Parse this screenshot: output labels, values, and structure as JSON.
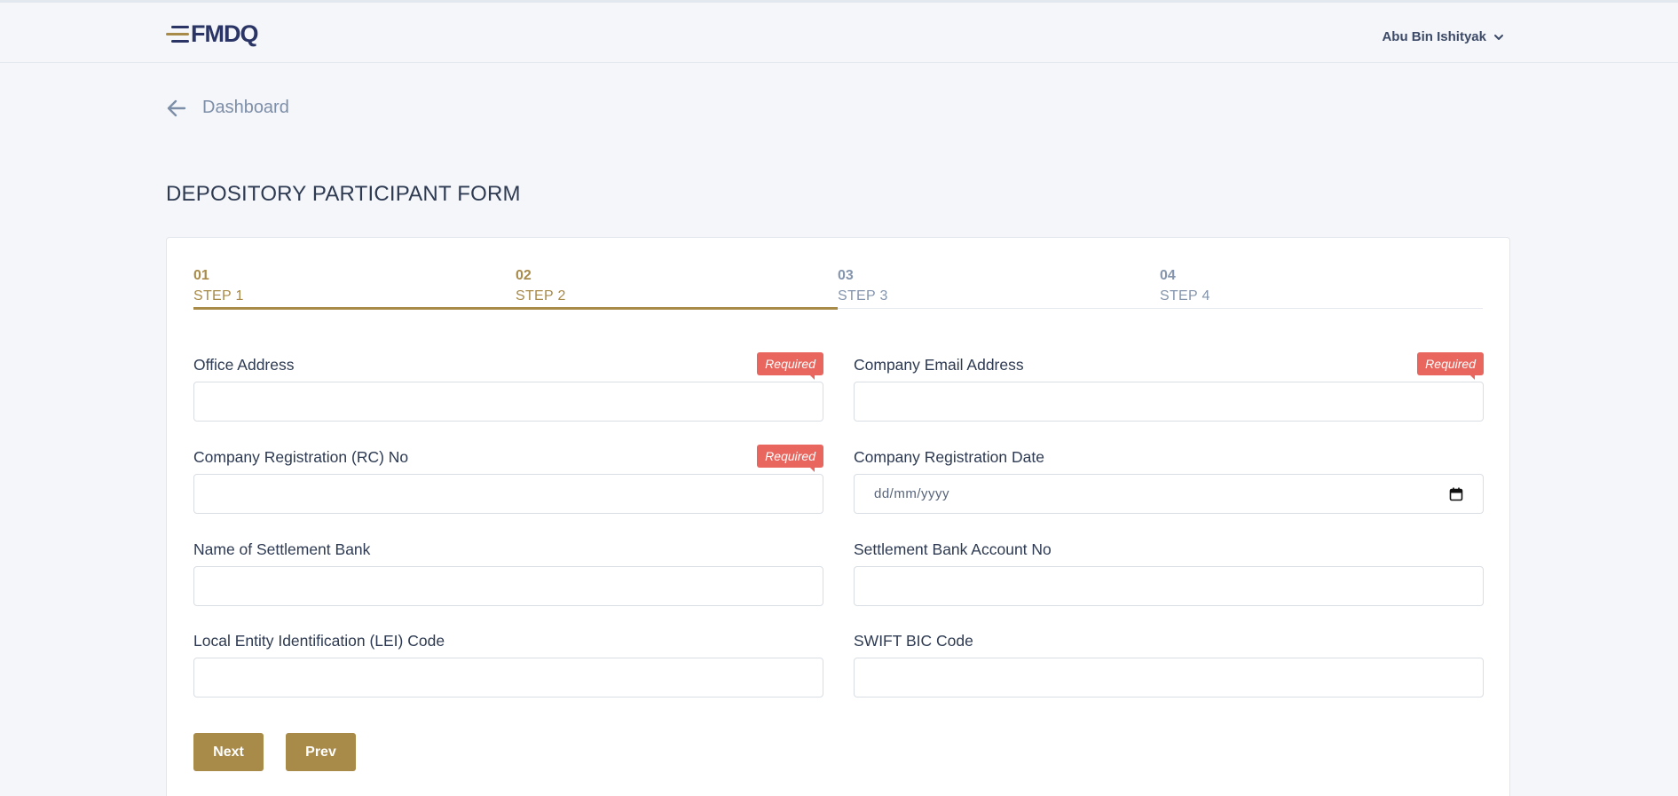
{
  "header": {
    "logo_text": "FMDQ",
    "user_name": "Abu Bin Ishityak"
  },
  "nav": {
    "back_label": "Dashboard"
  },
  "page": {
    "title": "DEPOSITORY PARTICIPANT FORM"
  },
  "steps": [
    {
      "number": "01",
      "label": "STEP 1",
      "state": "completed"
    },
    {
      "number": "02",
      "label": "STEP 2",
      "state": "completed"
    },
    {
      "number": "03",
      "label": "STEP 3",
      "state": "pending"
    },
    {
      "number": "04",
      "label": "STEP 4",
      "state": "pending"
    }
  ],
  "form": {
    "required_badge": "Required",
    "fields": {
      "office_address": {
        "label": "Office Address",
        "value": ""
      },
      "company_email": {
        "label": "Company Email Address",
        "value": ""
      },
      "rc_no": {
        "label": "Company Registration (RC) No",
        "value": ""
      },
      "reg_date": {
        "label": "Company Registration Date",
        "placeholder": "dd/mm/yyyy"
      },
      "settlement_bank": {
        "label": "Name of Settlement Bank",
        "value": ""
      },
      "settlement_account": {
        "label": "Settlement Bank Account No",
        "value": ""
      },
      "lei_code": {
        "label": "Local Entity Identification (LEI) Code",
        "value": ""
      },
      "swift_code": {
        "label": "SWIFT BIC Code",
        "value": ""
      }
    },
    "next_label": "Next",
    "prev_label": "Prev"
  },
  "colors": {
    "accent": "#a88a49",
    "required_badge": "#e8665e",
    "brand_navy": "#2a3566"
  }
}
